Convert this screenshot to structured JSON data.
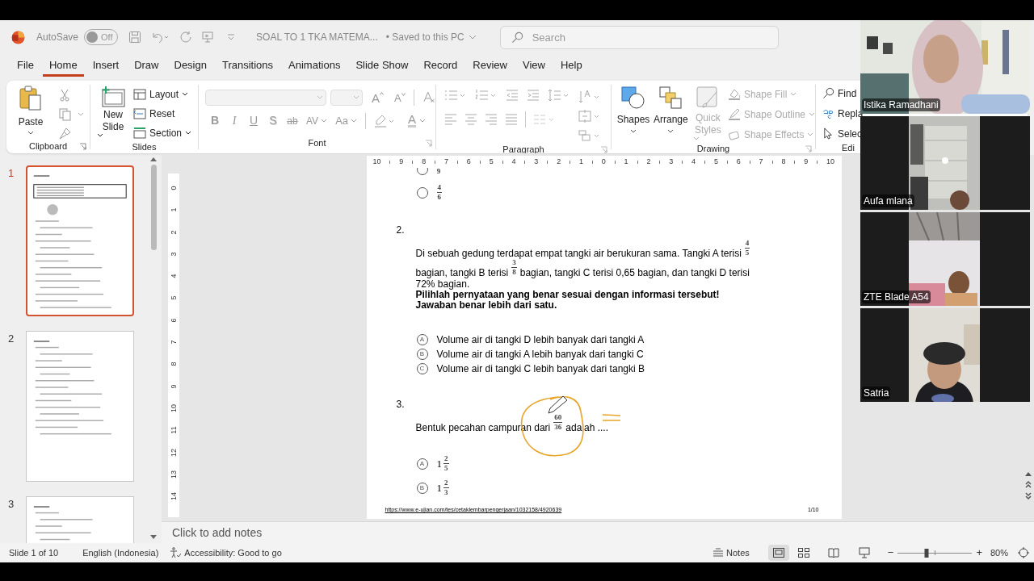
{
  "title_bar": {
    "autosave": "AutoSave",
    "autosave_toggle": {
      "label": "Off",
      "on": false
    },
    "document_title": "SOAL TO 1 TKA MATEMA...",
    "save_status": "• Saved to this PC",
    "search": {
      "placeholder": "Search"
    }
  },
  "menu_tabs": [
    {
      "label": "File",
      "selected": false
    },
    {
      "label": "Home",
      "selected": true
    },
    {
      "label": "Insert",
      "selected": false
    },
    {
      "label": "Draw",
      "selected": false
    },
    {
      "label": "Design",
      "selected": false
    },
    {
      "label": "Transitions",
      "selected": false
    },
    {
      "label": "Animations",
      "selected": false
    },
    {
      "label": "Slide Show",
      "selected": false
    },
    {
      "label": "Record",
      "selected": false
    },
    {
      "label": "Review",
      "selected": false
    },
    {
      "label": "View",
      "selected": false
    },
    {
      "label": "Help",
      "selected": false
    }
  ],
  "ribbon": {
    "clipboard": {
      "title": "Clipboard",
      "paste": "Paste"
    },
    "slides": {
      "title": "Slides",
      "new_slide": "New Slide",
      "commands": [
        {
          "label": "Layout",
          "dropdown": true
        },
        {
          "label": "Reset",
          "dropdown": false
        },
        {
          "label": "Section",
          "dropdown": true
        }
      ]
    },
    "font": {
      "title": "Font",
      "grow": "A",
      "shrink": "A",
      "styles": [
        {
          "label": "B",
          "kind": "bold"
        },
        {
          "label": "I",
          "kind": "italic"
        },
        {
          "label": "U",
          "kind": "underline"
        },
        {
          "label": "S",
          "kind": "shadow"
        },
        {
          "label": "ab",
          "kind": "strike"
        },
        {
          "label": "AV",
          "kind": "spacing"
        },
        {
          "label": "Aa",
          "kind": "case"
        }
      ],
      "font_color": "A"
    },
    "paragraph": {
      "title": "Paragraph"
    },
    "drawing": {
      "title": "Drawing",
      "shapes": "Shapes",
      "arrange": "Arrange",
      "quick_styles": {
        "label": "Quick Styles",
        "disabled": true
      },
      "format": [
        {
          "label": "Shape Fill",
          "disabled": true
        },
        {
          "label": "Shape Outline",
          "disabled": true
        },
        {
          "label": "Shape Effects",
          "disabled": true
        }
      ]
    },
    "editing": {
      "title": "Edi",
      "commands": [
        "Find",
        "Repla",
        "Selec"
      ]
    }
  },
  "thumbnails": [
    {
      "number": "1",
      "selected": true
    },
    {
      "number": "2",
      "selected": false
    },
    {
      "number": "3",
      "selected": false
    }
  ],
  "rulers": {
    "horizontal": [
      "10",
      "9",
      "8",
      "7",
      "6",
      "5",
      "4",
      "3",
      "2",
      "1",
      "0",
      "1",
      "2",
      "3",
      "4",
      "5",
      "6",
      "7",
      "8",
      "9",
      "10"
    ],
    "vertical": [
      "0",
      "1",
      "2",
      "3",
      "4",
      "5",
      "6",
      "7",
      "8",
      "9",
      "10",
      "11",
      "12",
      "13",
      "14"
    ]
  },
  "slide": {
    "questions": [
      {
        "options": [
          {
            "selected": false,
            "fraction": {
              "denominator": "9"
            }
          },
          {
            "selected": false,
            "fraction": {
              "numerator": "4",
              "denominator": "6"
            }
          }
        ]
      },
      {
        "number": "2.",
        "lines": [
          [
            {
              "kind": "text",
              "text": "Di sebuah gedung terdapat empat tangki air berukuran sama. Tangki A terisi"
            },
            {
              "kind": "fraction",
              "numerator": "4",
              "denominator": "5"
            }
          ],
          [
            {
              "kind": "text",
              "text": "bagian, tangki B terisi"
            },
            {
              "kind": "fraction",
              "numerator": "3",
              "denominator": "8"
            },
            {
              "kind": "text",
              "text": "bagian, tangki C terisi 0,65 bagian, dan tangki D terisi"
            }
          ],
          [
            {
              "kind": "text",
              "text": "72% bagian."
            }
          ]
        ],
        "instructions": [
          "Pilihlah pernyataan yang benar sesuai dengan informasi tersebut!",
          "Jawaban benar lebih dari satu."
        ],
        "options": [
          {
            "letter": "A",
            "text": "Volume air di tangki D lebih banyak dari tangki A"
          },
          {
            "letter": "B",
            "text": "Volume air di tangki A lebih banyak dari tangki C"
          },
          {
            "letter": "C",
            "text": "Volume air di tangki C lebih banyak dari tangki B"
          }
        ]
      },
      {
        "number": "3.",
        "lines": [
          [
            {
              "kind": "text",
              "text": "Bentuk pecahan campuran dari"
            },
            {
              "kind": "fraction",
              "numerator": "60",
              "denominator": "36"
            },
            {
              "kind": "text",
              "text": "adalah ...."
            }
          ]
        ],
        "options": [
          {
            "letter": "A",
            "whole": "1",
            "fraction": {
              "numerator": "2",
              "denominator": "5"
            }
          },
          {
            "letter": "B",
            "whole": "1",
            "fraction": {
              "numerator": "2",
              "denominator": "3"
            }
          }
        ]
      }
    ],
    "footer": {
      "link": "https://www.e-ujian.com/tes/cetaklembarpengerjaan/1032158/4920639",
      "page": "1/10"
    }
  },
  "notes": {
    "placeholder": "Click to add notes"
  },
  "status_bar": {
    "slide_count": "Slide 1 of 10",
    "language": "English (Indonesia)",
    "accessibility": "Accessibility: Good to go",
    "notes": "Notes",
    "zoom_out": "−",
    "zoom_in": "+",
    "zoom": {
      "level": 0.39
    },
    "zoom_percent": "80%"
  },
  "participants": [
    {
      "name": "Istika Ramadhani",
      "kind": "wide"
    },
    {
      "name": "Aufa mlana",
      "kind": "portrait"
    },
    {
      "name": "ZTE Blade A54",
      "kind": "portrait"
    },
    {
      "name": "Satria",
      "kind": "portrait"
    }
  ]
}
